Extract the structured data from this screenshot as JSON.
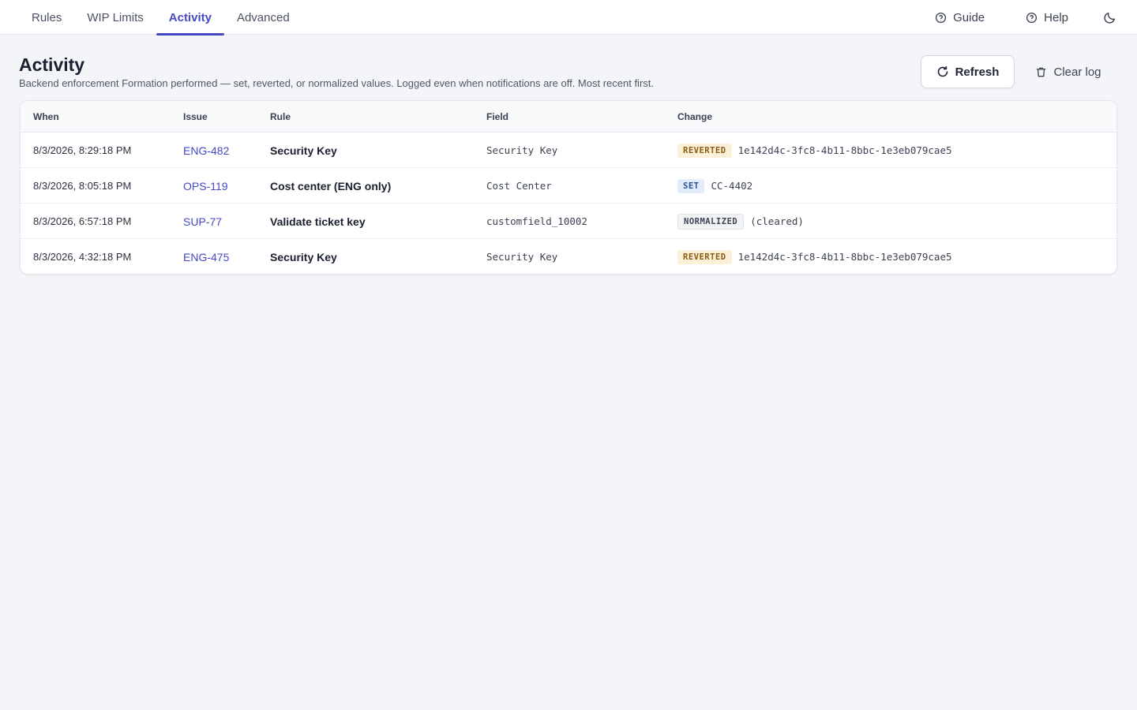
{
  "nav": {
    "tabs": [
      {
        "label": "Rules"
      },
      {
        "label": "WIP Limits"
      },
      {
        "label": "Activity"
      },
      {
        "label": "Advanced"
      }
    ],
    "active_tab": "Activity",
    "guide_label": "Guide",
    "help_label": "Help",
    "theme_icon": "moon-icon"
  },
  "header": {
    "title": "Activity",
    "subtitle": "Backend enforcement Formation performed — set, reverted, or normalized values. Logged even when notifications are off. Most recent first.",
    "refresh_label": "Refresh",
    "clear_label": "Clear log"
  },
  "table": {
    "columns": {
      "when": "When",
      "issue": "Issue",
      "rule": "Rule",
      "field": "Field",
      "change": "Change"
    },
    "rows": [
      {
        "when": "8/3/2026, 8:29:18 PM",
        "issue": "ENG-482",
        "rule": "Security Key",
        "field": "Security Key",
        "badge": "REVERTED",
        "badge_type": "reverted",
        "value": "1e142d4c-3fc8-4b11-8bbc-1e3eb079cae5"
      },
      {
        "when": "8/3/2026, 8:05:18 PM",
        "issue": "OPS-119",
        "rule": "Cost center (ENG only)",
        "field": "Cost Center",
        "badge": "SET",
        "badge_type": "set",
        "value": "CC-4402"
      },
      {
        "when": "8/3/2026, 6:57:18 PM",
        "issue": "SUP-77",
        "rule": "Validate ticket key",
        "field": "customfield_10002",
        "badge": "NORMALIZED",
        "badge_type": "normalized",
        "value": "(cleared)"
      },
      {
        "when": "8/3/2026, 4:32:18 PM",
        "issue": "ENG-475",
        "rule": "Security Key",
        "field": "Security Key",
        "badge": "REVERTED",
        "badge_type": "reverted",
        "value": "1e142d4c-3fc8-4b11-8bbc-1e3eb079cae5"
      }
    ]
  },
  "colors": {
    "accent": "#4548c5",
    "reverted_bg": "#fdf0d9",
    "set_bg": "#e3ecfb",
    "normalized_bg": "#f2f3f6"
  }
}
